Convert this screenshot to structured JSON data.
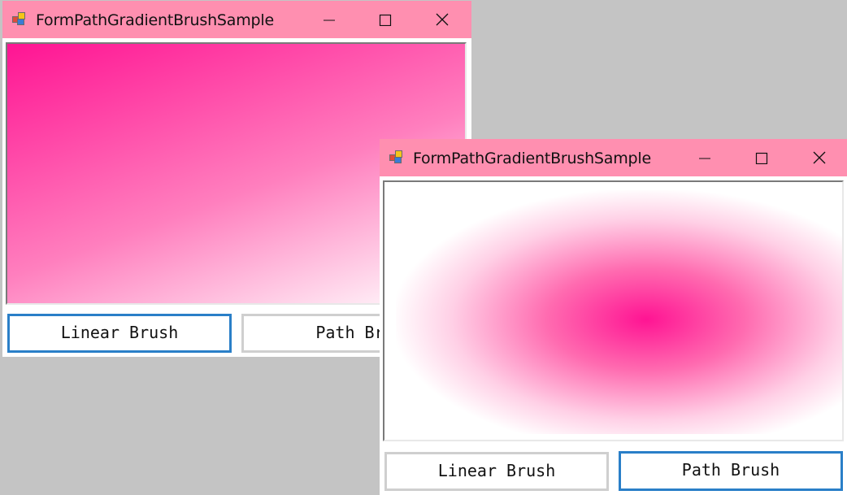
{
  "windows": [
    {
      "title": "FormPathGradientBrushSample",
      "canvas_fill": "linear-gradient",
      "buttons": {
        "linear_label": "Linear Brush",
        "path_label": "Path Bru"
      }
    },
    {
      "title": "FormPathGradientBrushSample",
      "canvas_fill": "path-gradient",
      "buttons": {
        "linear_label": "Linear Brush",
        "path_label": "Path Brush"
      }
    }
  ],
  "controls": {
    "minimize_icon": "minimize-icon",
    "maximize_icon": "maximize-icon",
    "close_icon": "close-icon"
  },
  "colors": {
    "titlebar": "#ff8fb0",
    "gradient_start": "#ff1493",
    "gradient_end": "#ffffff",
    "focus_border": "#2a7fc8",
    "desktop": "#c4c4c4"
  }
}
